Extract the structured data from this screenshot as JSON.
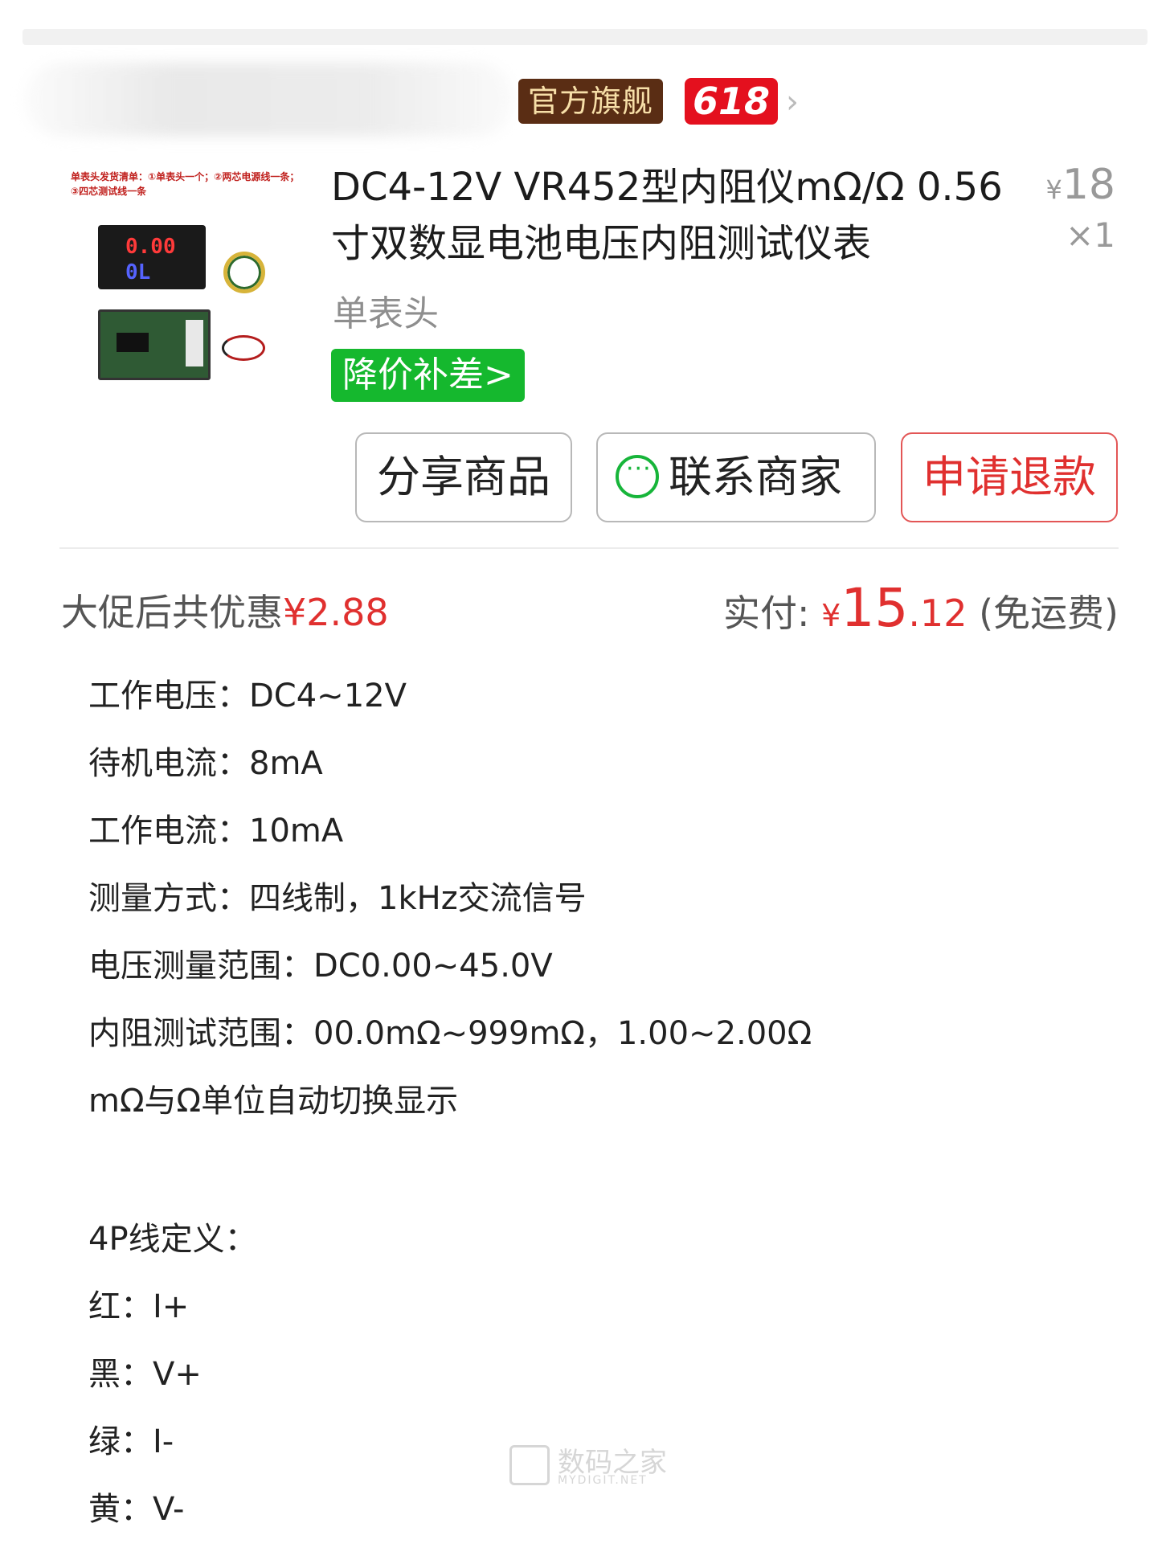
{
  "store": {
    "badge_official": "官方旗舰",
    "badge_618": "618",
    "chevron": "›"
  },
  "product": {
    "image_caption": "单表头发货清单：①单表头一个；②两芯电源线一条；③四芯测试线一条",
    "meter_top": "0.00",
    "meter_bottom": "0L",
    "title": "DC4-12V VR452型内阻仪mΩ/Ω 0.56寸双数显电池电压内阻测试仪表",
    "unit_price_symbol": "¥",
    "unit_price": "18",
    "quantity": "×1",
    "variant": "单表头",
    "price_diff_label": "降价补差>"
  },
  "actions": {
    "share": "分享商品",
    "contact": "联系商家",
    "refund": "申请退款"
  },
  "summary": {
    "discount_label": "大促后共优惠",
    "discount_amount": "¥2.88",
    "paid_label": "实付:",
    "paid_currency": "¥",
    "paid_integer": "15",
    "paid_decimal": ".12",
    "shipping_note": "(免运费)"
  },
  "specs": [
    "工作电压：DC4~12V",
    "待机电流：8mA",
    "工作电流：10mA",
    "测量方式：四线制，1kHz交流信号",
    "电压测量范围：DC0.00~45.0V",
    "内阻测试范围：00.0mΩ~999mΩ，1.00~2.00Ω",
    "mΩ与Ω单位自动切换显示"
  ],
  "wiring": {
    "heading": "4P线定义：",
    "lines": [
      "红：I+",
      "黑：V+",
      "绿：I-",
      "黄：V-"
    ]
  },
  "watermark": {
    "cn": "数码之家",
    "en": "MYDIGIT.NET"
  },
  "colors": {
    "accent_red": "#e0302f",
    "official_badge_bg": "#5a2d14",
    "badge_618_bg": "#e4101e",
    "price_diff_green": "#15b82e",
    "wechat_green": "#17b53a"
  }
}
